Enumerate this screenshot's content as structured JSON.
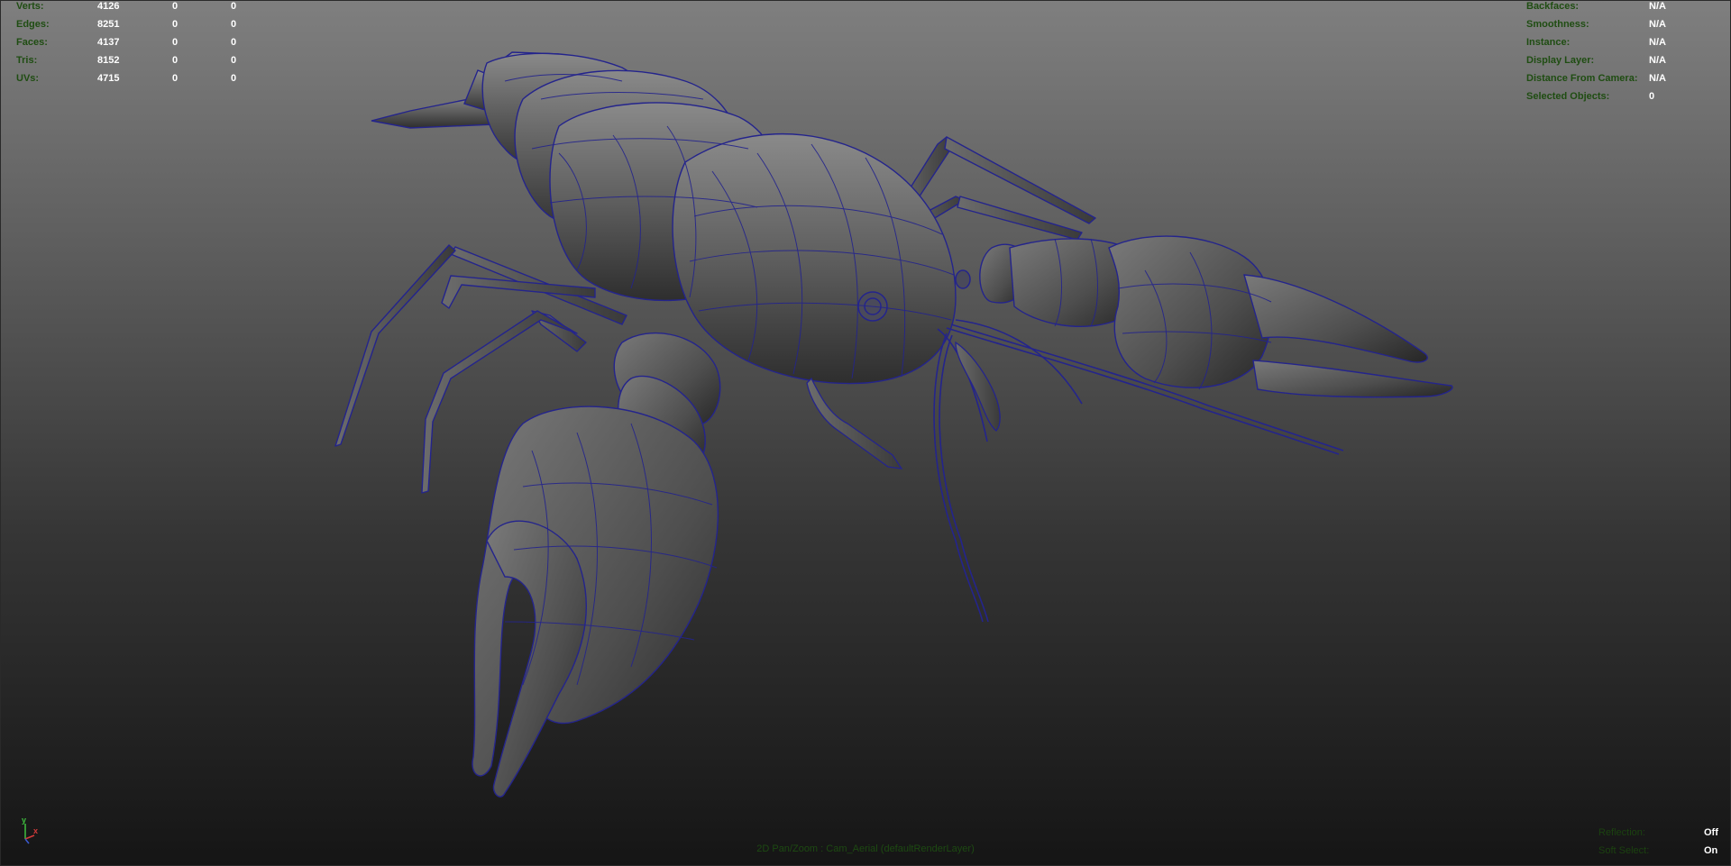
{
  "stats": {
    "rows": [
      {
        "label": "Verts:",
        "values": [
          "4126",
          "0",
          "0"
        ]
      },
      {
        "label": "Edges:",
        "values": [
          "8251",
          "0",
          "0"
        ]
      },
      {
        "label": "Faces:",
        "values": [
          "4137",
          "0",
          "0"
        ]
      },
      {
        "label": "Tris:",
        "values": [
          "8152",
          "0",
          "0"
        ]
      },
      {
        "label": "UVs:",
        "values": [
          "4715",
          "0",
          "0"
        ]
      }
    ]
  },
  "info": {
    "rows": [
      {
        "label": "Backfaces:",
        "value": "N/A"
      },
      {
        "label": "Smoothness:",
        "value": "N/A"
      },
      {
        "label": "Instance:",
        "value": "N/A"
      },
      {
        "label": "Display Layer:",
        "value": "N/A"
      },
      {
        "label": "Distance From Camera:",
        "value": "N/A"
      },
      {
        "label": "Selected Objects:",
        "value": "0"
      }
    ]
  },
  "render_settings": {
    "rows": [
      {
        "label": "Reflection:",
        "value": "Off"
      },
      {
        "label": "Soft Select:",
        "value": "On"
      }
    ]
  },
  "camera": {
    "label": "2D Pan/Zoom : Cam_Aerial (defaultRenderLayer)"
  },
  "axis": {
    "y_label": "y",
    "x_label": "x"
  },
  "colors": {
    "hud_label": "#1f4d12",
    "hud_value": "#ffffff",
    "wireframe": "#24248c",
    "mesh_fill": "#5c5c5c"
  },
  "model": {
    "icon": "crayfish-wireframe-mesh"
  }
}
